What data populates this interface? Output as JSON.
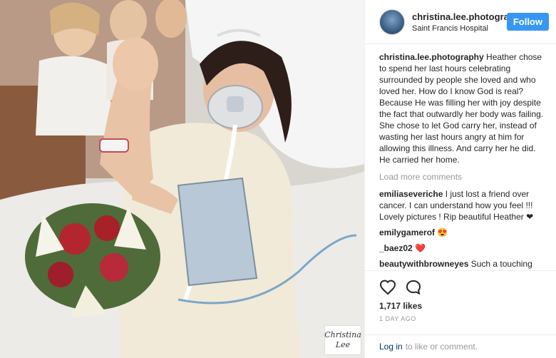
{
  "photo": {
    "alt": "",
    "watermark_line1": "Christina",
    "watermark_line2": "Lee"
  },
  "header": {
    "username": "christina.lee.photography",
    "location": "Saint Francis Hospital",
    "follow_label": "Follow"
  },
  "caption": {
    "user": "christina.lee.photography",
    "text": "Heather chose to spend her last hours celebrating surrounded by people she loved and who loved her. How do I know God is real? Because He was filling her with joy despite the fact that outwardly her body was failing. She chose to let God carry her, instead of wasting her last hours angry at him for allowing this illness. And carry her he did. He carried her home."
  },
  "load_more": "Load more comments",
  "comments": [
    {
      "user": "emiliaseveriche",
      "text": "I just lost a friend over cancer. I can understand how you feel !!! Lovely pictures ! Rip beautiful Heather ❤"
    },
    {
      "user": "emilygamerof",
      "text": "😍"
    },
    {
      "user": "_baez02",
      "text": "❤️"
    },
    {
      "user": "beautywithbrowneyes",
      "text": "Such a touching story!! Love always wins!!!"
    }
  ],
  "actions": {
    "like_icon": "heart-icon",
    "comment_icon": "comment-icon",
    "likes": "1,717 likes",
    "date": "1 DAY AGO"
  },
  "login": {
    "link": "Log in",
    "text": "to like or comment."
  },
  "colors": {
    "accent": "#3897f0",
    "heart": "#ed4956"
  }
}
